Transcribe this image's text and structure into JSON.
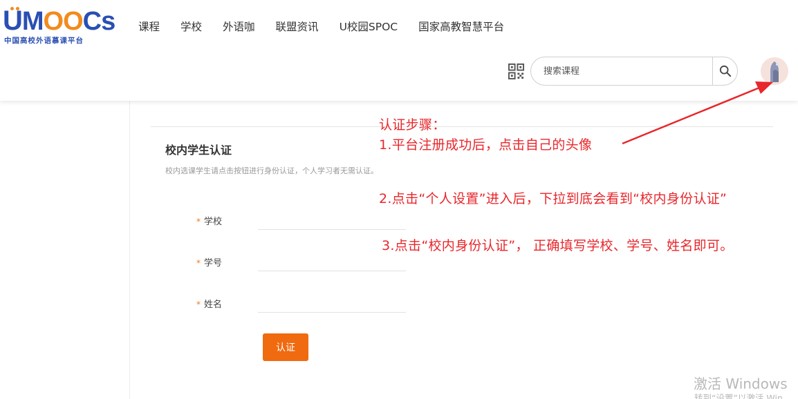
{
  "header": {
    "logo": {
      "word_u": "U",
      "word_m": "M",
      "word_oo": "OO",
      "word_cs": "Cs",
      "subtitle": "中国高校外语慕课平台"
    },
    "nav": [
      "课程",
      "学校",
      "外语咖",
      "联盟资讯",
      "U校园SPOC",
      "国家高教智慧平台"
    ],
    "search": {
      "placeholder": "搜索课程",
      "value": ""
    },
    "icons": {
      "qr": "qr-code-icon",
      "search": "search-icon",
      "avatar": "user-avatar"
    }
  },
  "main": {
    "title": "校内学生认证",
    "description": "校内选课学生请点击按钮进行身份认证，个人学习者无需认证。",
    "fields": [
      {
        "required_mark": "*",
        "label": "学校",
        "value": ""
      },
      {
        "required_mark": "*",
        "label": "学号",
        "value": ""
      },
      {
        "required_mark": "*",
        "label": "姓名",
        "value": ""
      }
    ],
    "submit_label": "认证"
  },
  "annotations": {
    "heading": "认证步骤：",
    "step1": "1.平台注册成功后，点击自己的头像",
    "step2": "2.点击“个人设置”进入后，下拉到底会看到“校内身份认证”",
    "step3": "3.点击“校内身份认证”， 正确填写学校、学号、姓名即可。",
    "color": "#e8262b"
  },
  "watermark": {
    "line1": "激活 Windows",
    "line2": "转到“设置”以激活 Win"
  },
  "colors": {
    "brand_blue": "#2a4fb4",
    "brand_orange": "#f28b1e",
    "submit_button": "#f06a0f",
    "required_star": "#f07a1a"
  }
}
